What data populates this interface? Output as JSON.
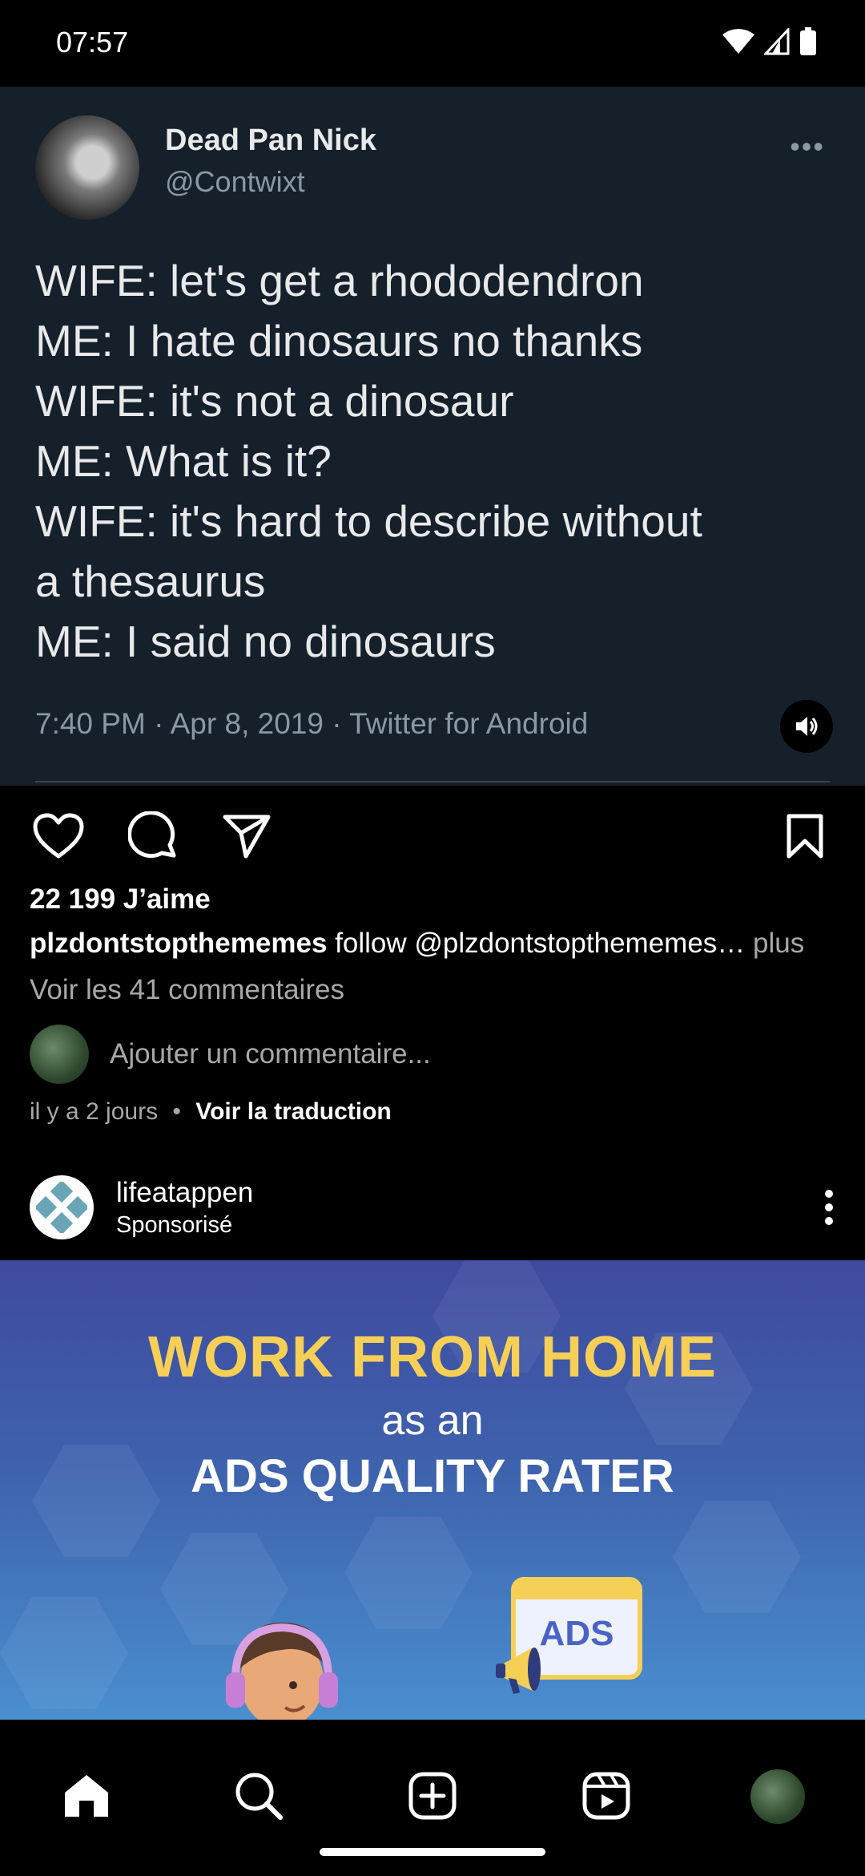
{
  "status_bar": {
    "time": "07:57"
  },
  "tweet": {
    "name": "Dead Pan Nick",
    "handle": "@Contwixt",
    "lines": [
      "WIFE: let's get a rhododendron",
      "ME: I hate dinosaurs no thanks",
      "WIFE: it's not a dinosaur",
      "ME: What is it?",
      "WIFE: it's hard to describe without",
      "a thesaurus",
      "ME: I said no dinosaurs"
    ],
    "meta": "7:40 PM · Apr 8, 2019 · Twitter for Android"
  },
  "post": {
    "likes": "22 199 J’aime",
    "caption_user": "plzdontstopthememes",
    "caption_text": " follow @plzdontstopthememes… ",
    "caption_more": "plus",
    "comments_link": "Voir les 41 commentaires",
    "add_comment_placeholder": "Ajouter un commentaire...",
    "time_ago": "il y a 2 jours",
    "separator": "•",
    "translate": "Voir la traduction"
  },
  "sponsored": {
    "name": "lifeatappen",
    "label": "Sponsorisé"
  },
  "ad": {
    "title_line1": "WORK FROM HOME",
    "title_line2": "as an",
    "title_line3": "ADS QUALITY RATER",
    "browser_label": "ADS"
  },
  "colors": {
    "tweet_bg": "#15202b",
    "ad_gold": "#f6cf56",
    "ad_blue": "#3f4a9e"
  }
}
